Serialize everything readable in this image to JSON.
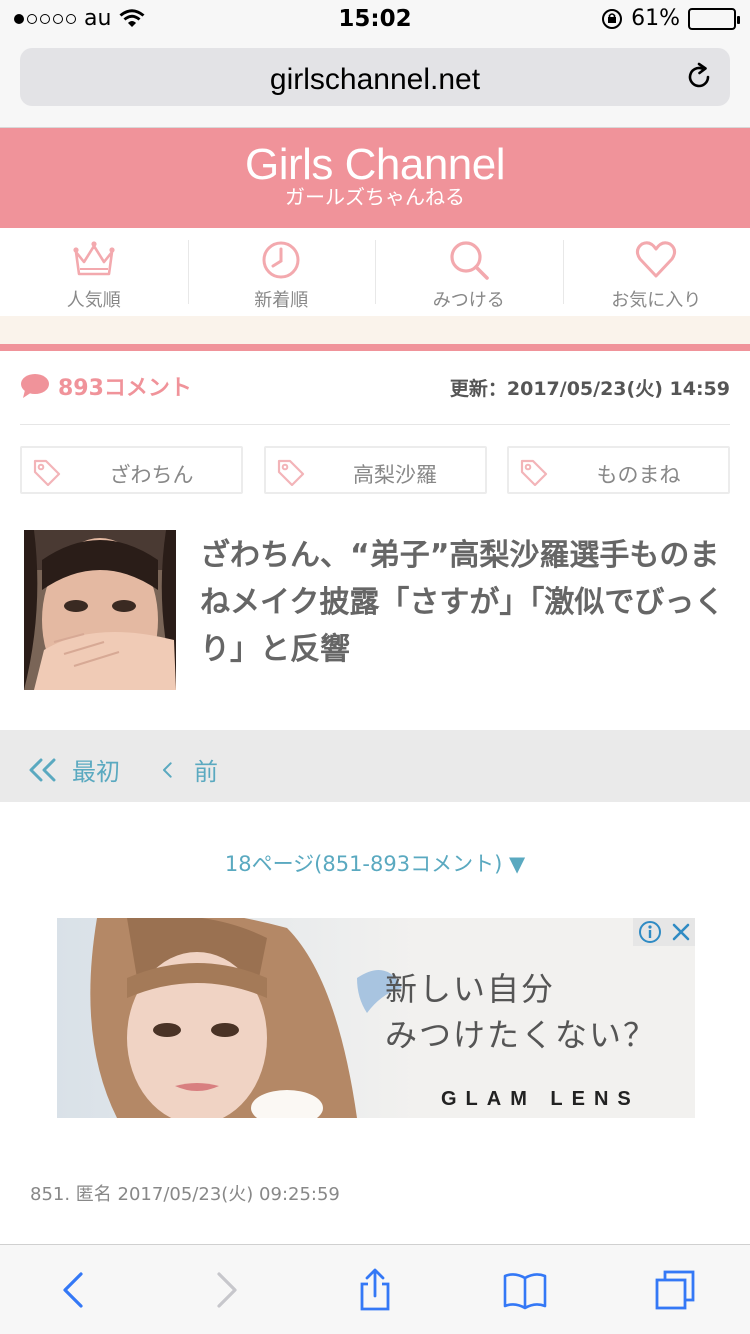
{
  "status": {
    "carrier": "au",
    "time": "15:02",
    "battery": "61%",
    "battery_level": 0.61
  },
  "browser": {
    "url": "girlschannel.net"
  },
  "header": {
    "logo_en": "Girls Channel",
    "logo_jp": "ガールズちゃんねる",
    "accent_color": "#f0939a"
  },
  "nav": {
    "items": [
      {
        "label": "人気順",
        "icon": "crown-icon"
      },
      {
        "label": "新着順",
        "icon": "clock-icon"
      },
      {
        "label": "みつける",
        "icon": "search-icon"
      },
      {
        "label": "お気に入り",
        "icon": "heart-icon"
      }
    ]
  },
  "topic": {
    "comment_count": "893コメント",
    "updated": "更新：2017/05/23(火) 14:59",
    "tags": [
      "ざわちん",
      "高梨沙羅",
      "ものまね"
    ],
    "title": "ざわちん、“弟子”高梨沙羅選手ものまねメイク披露「さすが」「激似でびっくり」と反響"
  },
  "pager": {
    "first": "最初",
    "prev": "前",
    "page_select": "18ページ(851-893コメント) ▼"
  },
  "ad": {
    "copy_line1": "新しい自分",
    "copy_line2": "みつけたくない？",
    "brand": "GLAM LENS"
  },
  "comment": {
    "meta": "851. 匿名 2017/05/23(火) 09:25:59"
  }
}
